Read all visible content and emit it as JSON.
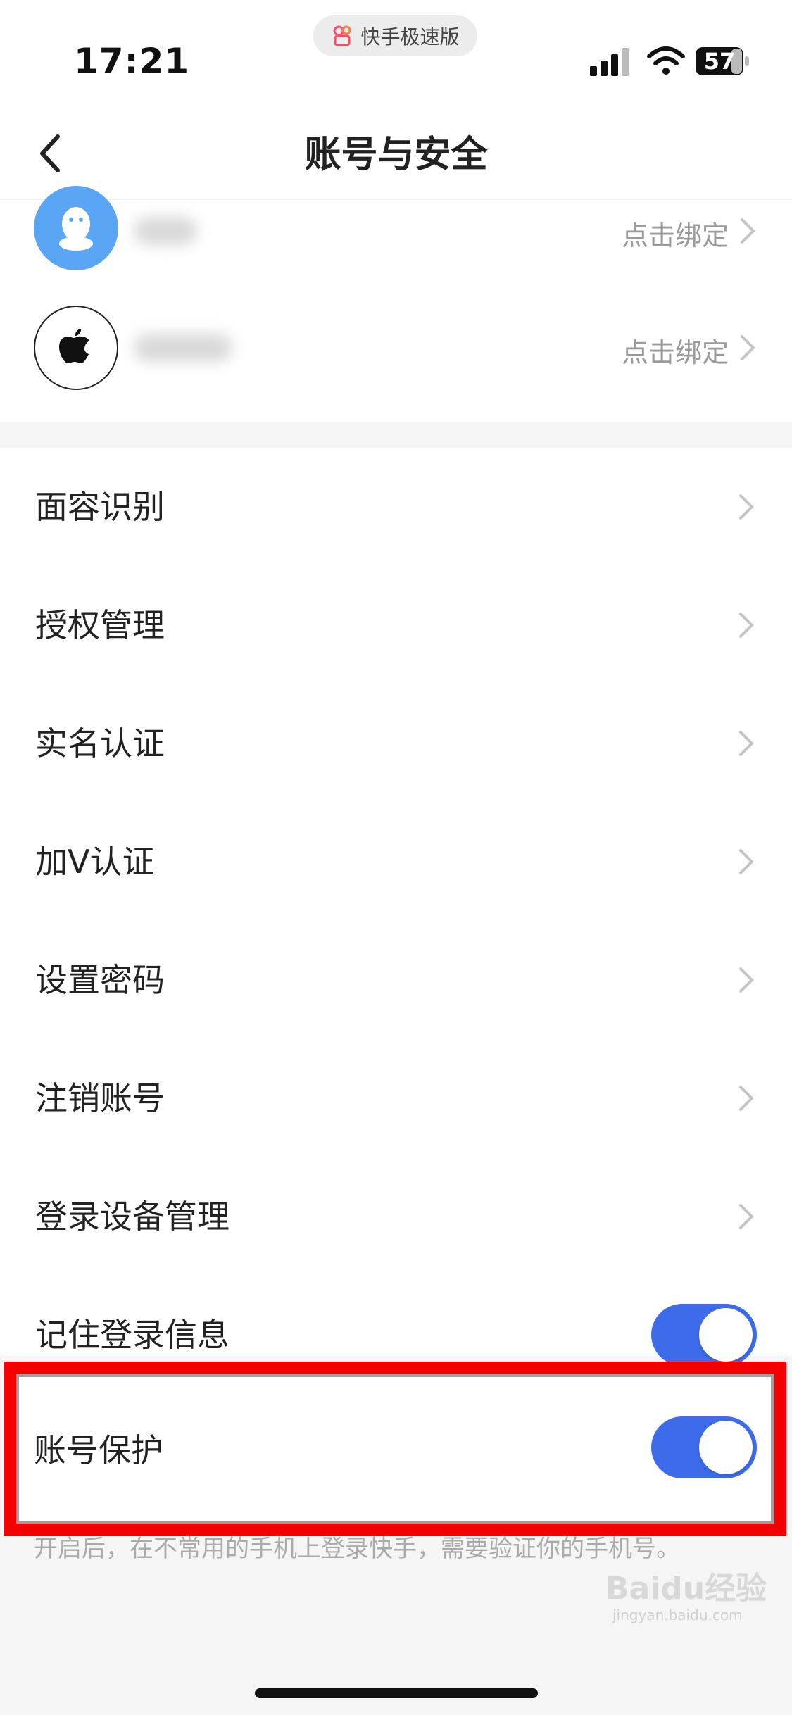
{
  "status_bar": {
    "time": "17:21",
    "app_name": "快手极速版",
    "battery": "57"
  },
  "header": {
    "title": "账号与安全"
  },
  "bindings": [
    {
      "icon": "qq-icon",
      "action": "点击绑定"
    },
    {
      "icon": "apple-icon",
      "action": "点击绑定"
    }
  ],
  "menu": {
    "items": [
      {
        "label": "面容识别"
      },
      {
        "label": "授权管理"
      },
      {
        "label": "实名认证"
      },
      {
        "label": "加V认证"
      },
      {
        "label": "设置密码"
      },
      {
        "label": "注销账号"
      },
      {
        "label": "登录设备管理"
      }
    ],
    "remember_login": {
      "label": "记住登录信息",
      "enabled": true
    },
    "account_protect": {
      "label": "账号保护",
      "enabled": true
    },
    "hint": "开启后，在不常用的手机上登录快手，需要验证你的手机号。"
  },
  "watermark": {
    "text": "Baidu经验",
    "url": "jingyan.baidu.com"
  },
  "colors": {
    "accent": "#3d6bea",
    "highlight": "#f30000",
    "qq": "#5aa6f5"
  }
}
